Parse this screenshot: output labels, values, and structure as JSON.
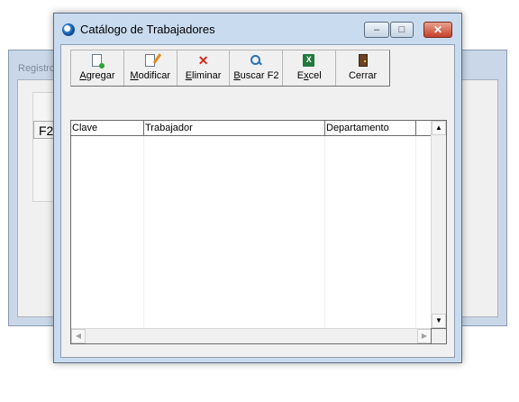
{
  "background_window": {
    "title": "Registro",
    "field_value": "F2"
  },
  "window": {
    "title": "Catálogo de Trabajadores",
    "controls": {
      "minimize": "–",
      "maximize": "□",
      "close": "✕"
    }
  },
  "toolbar": {
    "buttons": [
      {
        "label": "Agregar",
        "icon": "new-document-icon"
      },
      {
        "label": "Modificar",
        "icon": "edit-icon"
      },
      {
        "label": "Eliminar",
        "icon": "delete-icon"
      },
      {
        "label": "Buscar F2",
        "icon": "search-icon"
      },
      {
        "label": "Excel",
        "icon": "excel-icon"
      },
      {
        "label": "Cerrar",
        "icon": "door-exit-icon"
      }
    ],
    "excel_icon_text": "X"
  },
  "grid": {
    "columns": [
      "Clave",
      "Trabajador",
      "Departamento"
    ],
    "rows": [],
    "scroll_up": "▲",
    "scroll_down": "▼",
    "scroll_left": "◀",
    "scroll_right": "▶"
  },
  "colors": {
    "window_frame": "#c9dbef",
    "client": "#f0f0f0",
    "close_button": "#c4412a"
  }
}
